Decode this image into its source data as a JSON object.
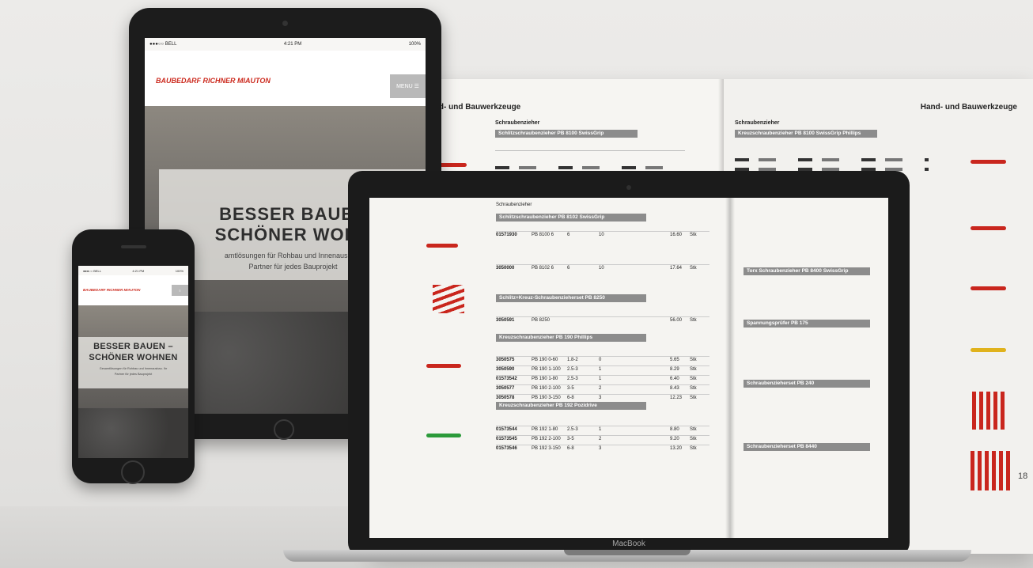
{
  "catalog": {
    "left_title": "Hand- und Bauwerkzeuge",
    "left_section": "Schraubenzieher",
    "left_bars": [
      "Schlitzschraubenzieher PB 8100 SwissGrip",
      "Schlitzschraubenzieher PB 8102 SwissGrip",
      "Schlitz+Kreuz-Schraubenzieherset PB 8250",
      "Kreuzschraubenzieher PB 190 Phillips",
      "Kreuzschraubenzieher PB 192 Pozidrive"
    ],
    "right_title": "Hand- und Bauwerkzeuge",
    "right_section": "Schraubenzieher",
    "right_bars": [
      "Kreuzschraubenzieher PB 8100 SwissGrip Phillips",
      "Torx Schraubenzieher PB 8400 SwissGrip",
      "Spannungsprüfer PB 175",
      "Schraubenzieherset PB 240",
      "Schraubenzieherset PB 8440"
    ],
    "page_number": "18"
  },
  "tablet": {
    "status_left": "●●●○○ BELL",
    "status_time": "4:21 PM",
    "status_right": "100%",
    "logo": "BAUBEDARF RICHNER MIAUTON",
    "menu": "MENU ☰",
    "hero_title_1": "BESSER BAUEN",
    "hero_title_2": "SCHÖNER WOHN",
    "hero_sub_1": "amtlösungen für Rohbau und Innenausbau.",
    "hero_sub_2": "Partner für jedes Bauprojekt"
  },
  "laptop": {
    "label": "MacBook",
    "section_label": "Schraubenzieher",
    "rows": [
      [
        "01571930",
        "PB 8100 6",
        "6",
        "10",
        "16.60",
        "Stk"
      ],
      [
        "3050000",
        "PB 8102 6",
        "6",
        "10",
        "17.64",
        "Stk"
      ],
      [
        "3050591",
        "PB 8250",
        "",
        "",
        "56.00",
        "Stk"
      ],
      [
        "3050575",
        "PB 190 0-60",
        "1.8-2",
        "0",
        "5.65",
        "Stk"
      ],
      [
        "3050590",
        "PB 190 1-100",
        "2.5-3",
        "1",
        "8.29",
        "Stk"
      ],
      [
        "01573542",
        "PB 190 1-80",
        "2.5-3",
        "1",
        "6.40",
        "Stk"
      ],
      [
        "3050577",
        "PB 190 2-100",
        "3-5",
        "2",
        "8.43",
        "Stk"
      ],
      [
        "3050578",
        "PB 190 3-150",
        "6-8",
        "3",
        "12.23",
        "Stk"
      ],
      [
        "01573544",
        "PB 192 1-80",
        "2.5-3",
        "1",
        "8.80",
        "Stk"
      ],
      [
        "01573545",
        "PB 192 2-100",
        "3-5",
        "2",
        "9.20",
        "Stk"
      ],
      [
        "01573546",
        "PB 192 3-150",
        "6-8",
        "3",
        "13.20",
        "Stk"
      ]
    ]
  },
  "phone": {
    "status_left": "●●●○○ BELL",
    "status_time": "4:21 PM",
    "status_right": "100%",
    "logo": "BAUBEDARF RICHNER MIAUTON",
    "hero_title_1": "BESSER BAUEN –",
    "hero_title_2": "SCHÖNER WOHNEN",
    "hero_sub_1": "Gesamtlösungen für Rohbau und Innenausbau. Ihr",
    "hero_sub_2": "Partner für jedes Bauprojekt"
  }
}
